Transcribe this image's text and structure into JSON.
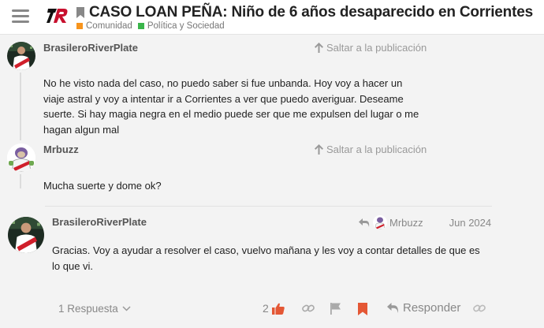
{
  "header": {
    "title": "CASO LOAN PEÑA: Niño de 6 años desaparecido en Corrientes",
    "categories": [
      {
        "label": "Comunidad",
        "color": "#f7941d"
      },
      {
        "label": "Política y Sociedad",
        "color": "#3ab54a"
      }
    ],
    "menu_icon": "hamburger-icon",
    "logo_icon": "site-logo"
  },
  "posts": [
    {
      "username": "BrasileroRiverPlate",
      "jump_label": "Saltar a la publicación",
      "text": "No he visto nada del caso, no puedo saber si fue unbanda. Hoy voy a hacer un viaje astral y voy a intentar ir a Corrientes a ver que puedo averiguar. Deseame suerte. Si hay magia negra en el medio puede ser que me expulsen del lugar o me hagan algun mal"
    },
    {
      "username": "Mrbuzz",
      "jump_label": "Saltar a la publicación",
      "text": "Mucha suerte y dome ok?"
    },
    {
      "username": "BrasileroRiverPlate",
      "reply_to_user": "Mrbuzz",
      "date": "Jun 2024",
      "text": "Gracias. Voy a ayudar a resolver el caso, vuelvo mañana y les voy a contar detalles de que es lo que vi."
    }
  ],
  "actions": {
    "replies_label": "1 Respuesta",
    "like_count": "2",
    "reply_label": "Responder",
    "colors": {
      "like": "#e45735",
      "bookmark": "#e45735",
      "muted": "#999999"
    }
  }
}
